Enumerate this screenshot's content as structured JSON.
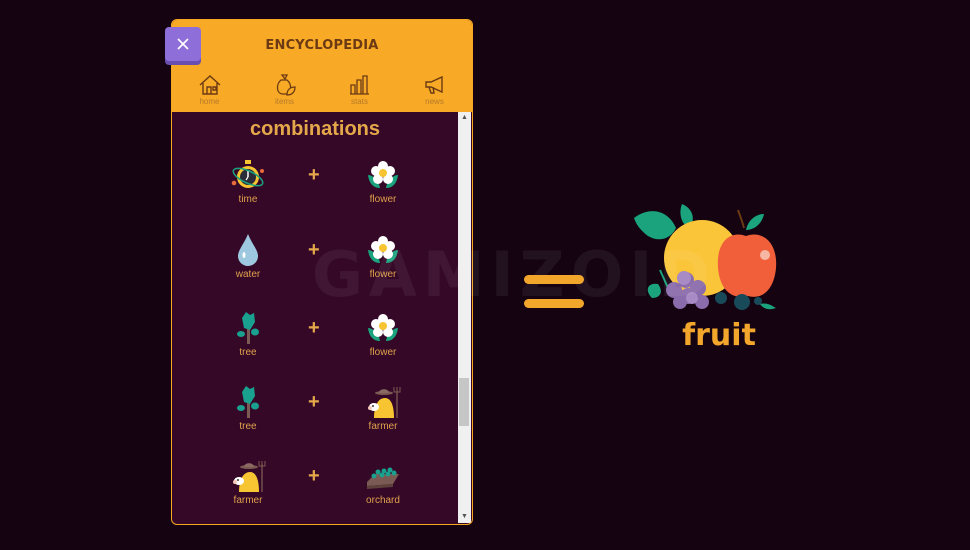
{
  "panel": {
    "title": "ENCYCLOPEDIA",
    "close_icon": "close-icon",
    "nav": [
      {
        "label": "home",
        "icon": "home-icon"
      },
      {
        "label": "items",
        "icon": "items-bag-icon"
      },
      {
        "label": "stats",
        "icon": "stats-icon"
      },
      {
        "label": "news",
        "icon": "megaphone-icon"
      }
    ],
    "section_title": "combinations",
    "combinations": [
      {
        "left": "time",
        "right": "flower",
        "operator": "+"
      },
      {
        "left": "water",
        "right": "flower",
        "operator": "+"
      },
      {
        "left": "tree",
        "right": "flower",
        "operator": "+"
      },
      {
        "left": "tree",
        "right": "farmer",
        "operator": "+"
      },
      {
        "left": "farmer",
        "right": "orchard",
        "operator": "+"
      }
    ],
    "scroll_position": 0.75
  },
  "result": {
    "operator": "=",
    "label": "fruit",
    "icon": "fruit-icon"
  },
  "watermark": "GAMIZOID",
  "colors": {
    "background": "#150312",
    "panel_bg": "#350828",
    "header_bg": "#f8a925",
    "accent": "#f2a62c",
    "close_button": "#8e6fd9"
  }
}
